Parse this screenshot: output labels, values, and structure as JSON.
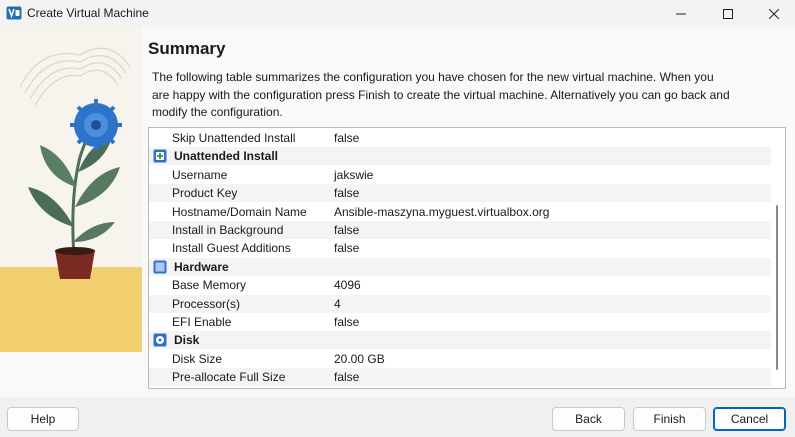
{
  "window": {
    "title": "Create Virtual Machine",
    "icon": "virtualbox-icon",
    "controls": {
      "minimize": "minimize-icon",
      "maximize": "maximize-icon",
      "close": "close-icon"
    }
  },
  "page": {
    "heading": "Summary",
    "description": "The following table summarizes the configuration you have chosen for the new virtual machine. When you are happy with the configuration press Finish to create the virtual machine. Alternatively you can go back and modify the configuration."
  },
  "summary": {
    "rows": [
      {
        "type": "item",
        "key": "Skip Unattended Install",
        "value": "false"
      },
      {
        "type": "section",
        "key": "Unattended Install",
        "icon": "unattended-install-icon"
      },
      {
        "type": "item",
        "key": "Username",
        "value": "jakswie"
      },
      {
        "type": "item",
        "key": "Product Key",
        "value": "false"
      },
      {
        "type": "item",
        "key": "Hostname/Domain Name",
        "value": "Ansible-maszyna.myguest.virtualbox.org"
      },
      {
        "type": "item",
        "key": "Install in Background",
        "value": "false"
      },
      {
        "type": "item",
        "key": "Install Guest Additions",
        "value": "false"
      },
      {
        "type": "section",
        "key": "Hardware",
        "icon": "hardware-icon"
      },
      {
        "type": "item",
        "key": "Base Memory",
        "value": "4096"
      },
      {
        "type": "item",
        "key": "Processor(s)",
        "value": "4"
      },
      {
        "type": "item",
        "key": "EFI Enable",
        "value": "false"
      },
      {
        "type": "section",
        "key": "Disk",
        "icon": "disk-icon"
      },
      {
        "type": "item",
        "key": "Disk Size",
        "value": "20.00 GB"
      },
      {
        "type": "item",
        "key": "Pre-allocate Full Size",
        "value": "false"
      }
    ]
  },
  "buttons": {
    "help": "Help",
    "back": "Back",
    "finish": "Finish",
    "cancel": "Cancel"
  },
  "colors": {
    "accent": "#0067c0",
    "section_icon_green": "#3aa63a",
    "section_icon_blue": "#2f6fd0"
  }
}
